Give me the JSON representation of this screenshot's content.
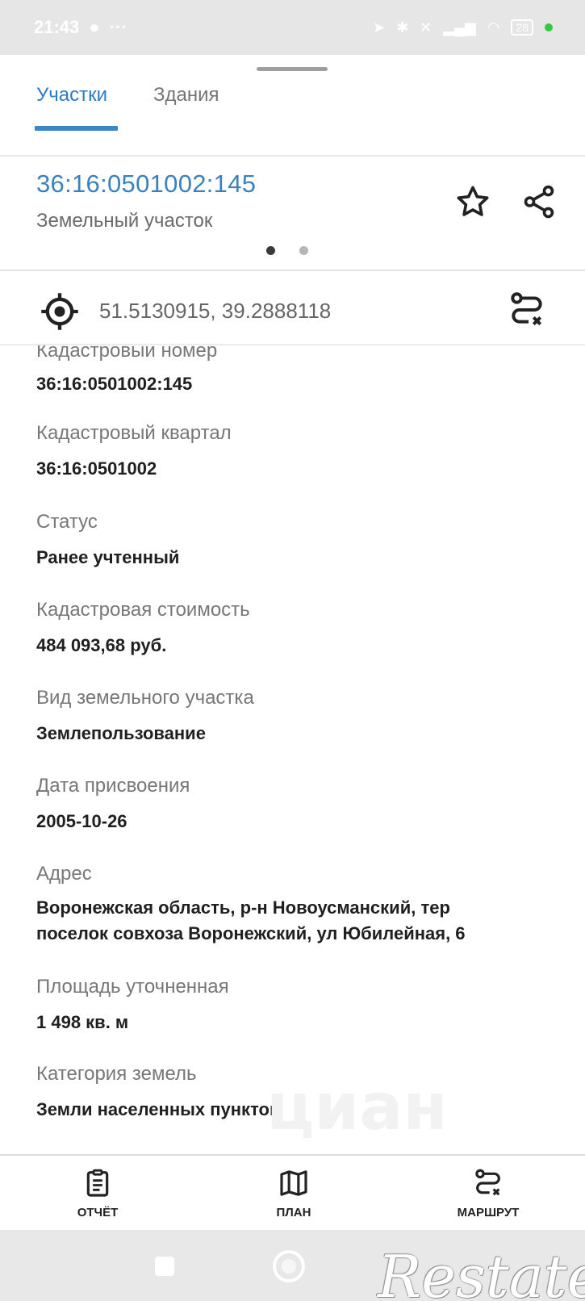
{
  "status_bar": {
    "time": "21:43",
    "battery": "28"
  },
  "tabs": [
    {
      "label": "Участки",
      "active": true
    },
    {
      "label": "Здания",
      "active": false
    }
  ],
  "parcel": {
    "id": "36:16:0501002:145",
    "type": "Земельный участок"
  },
  "coordinates": "51.5130915, 39.2888118",
  "fields": [
    {
      "label": "Кадастровый номер",
      "value": "36:16:0501002:145"
    },
    {
      "label": "Кадастровый квартал",
      "value": "36:16:0501002"
    },
    {
      "label": "Статус",
      "value": "Ранее учтенный"
    },
    {
      "label": "Кадастровая стоимость",
      "value": "484 093,68 руб."
    },
    {
      "label": "Вид земельного участка",
      "value": "Землепользование"
    },
    {
      "label": "Дата присвоения",
      "value": "2005-10-26"
    },
    {
      "label": "Адрес",
      "value_line1": "Воронежская область, р-н Новоусманский, тер",
      "value_line2": "поселок совхоза Воронежский, ул Юбилейная, 6"
    },
    {
      "label": "Площадь уточненная",
      "value": "1 498 кв. м"
    },
    {
      "label": "Категория земель",
      "value": "Земли населенных пунктов"
    }
  ],
  "bottom_nav": {
    "report_label": "ОТЧЁТ",
    "plan_label": "ПЛАН",
    "route_label": "МАРШРУТ"
  },
  "watermark": "циан",
  "logo": "Restate",
  "colors": {
    "accent": "#3b82bd",
    "tab_indicator": "#3a87c8"
  },
  "icons": [
    "star-icon",
    "share-icon",
    "target-icon",
    "route-icon",
    "report-icon",
    "map-icon"
  ]
}
